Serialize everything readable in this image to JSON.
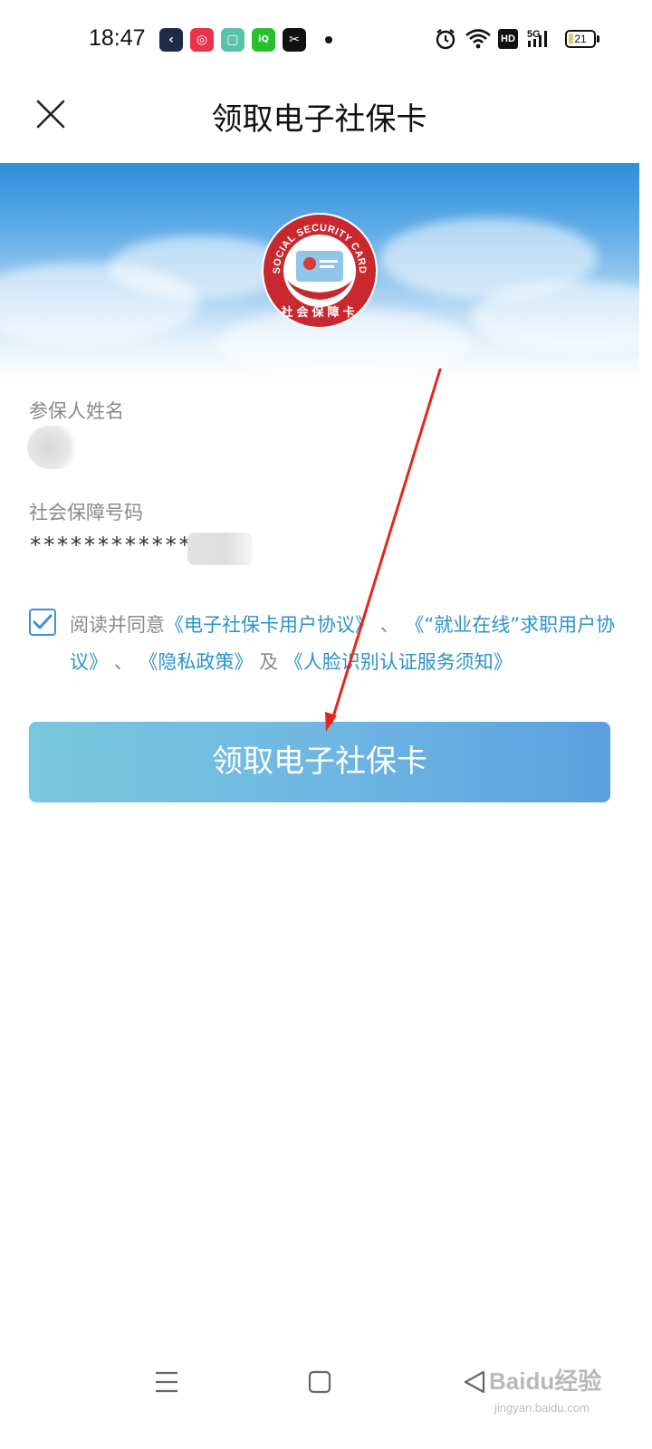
{
  "status_bar": {
    "time": "18:47",
    "apps": [
      {
        "icon": "back-app-icon",
        "color": "#1f2b4a"
      },
      {
        "icon": "shopping-app-icon",
        "color": "#e8334a"
      },
      {
        "icon": "reader-app-icon",
        "color": "#59c2a8"
      },
      {
        "icon": "iqiyi-app-icon",
        "color": "#25c02c"
      },
      {
        "icon": "capcut-app-icon",
        "color": "#111111"
      }
    ],
    "hd_label": "HD",
    "network_label": "5G",
    "battery": "21",
    "battery_level": 0.21
  },
  "header": {
    "title": "领取电子社保卡",
    "close_icon": "close-icon"
  },
  "banner": {
    "logo": {
      "ring_text": "SOCIAL SECURITY CARD",
      "bottom_text": "社会保障卡",
      "color": "#c8282e"
    }
  },
  "form": {
    "name_label": "参保人姓名",
    "id_label": "社会保障号码",
    "id_value": "*************"
  },
  "agreement": {
    "checked": true,
    "prefix": "阅读并同意",
    "link1": "《电子社保卡用户协议》",
    "sep1": "、",
    "link2": "《“就业在线”求职用户协议》",
    "sep2": "、",
    "link3": "《隐私政策》",
    "conj": "及",
    "link4": "《人脸识别认证服务须知》"
  },
  "primary_button": {
    "label": "领取电子社保卡"
  },
  "nav_bar": {
    "menu_icon": "menu-icon",
    "home_icon": "home-icon",
    "back_icon": "back-icon"
  },
  "watermark": {
    "main": "Baidu经验",
    "sub": "jingyan.baidu.com"
  },
  "colors": {
    "accent": "#2b93c8",
    "annotation_arrow": "#e8261c"
  }
}
